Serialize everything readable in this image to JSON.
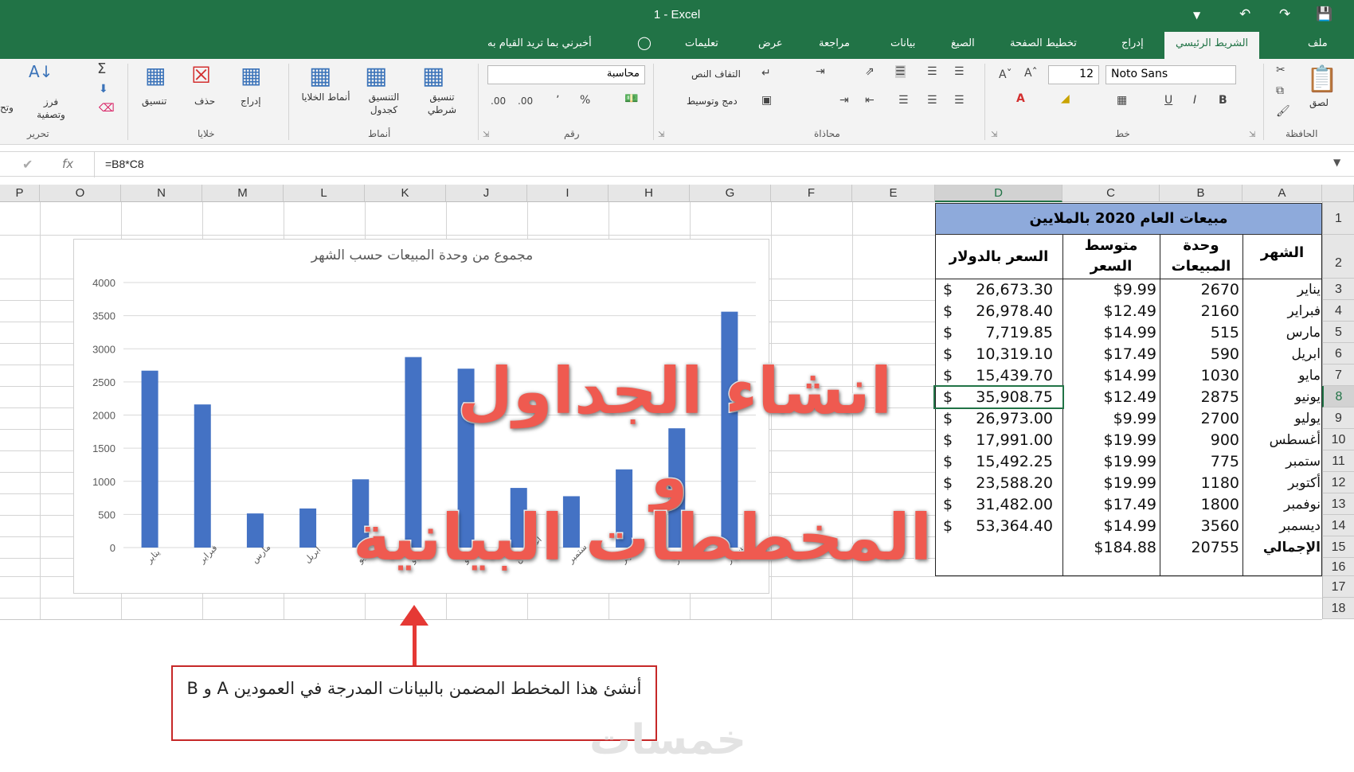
{
  "window": {
    "title": "1  -  Excel"
  },
  "tabs": {
    "file": "ملف",
    "home": "الشريط الرئيسي",
    "insert": "إدراج",
    "page_layout": "تخطيط الصفحة",
    "formulas": "الصيغ",
    "data": "بيانات",
    "review": "مراجعة",
    "view": "عرض",
    "help": "تعليمات",
    "tell_me": "أخبرني بما تريد القيام به"
  },
  "ribbon": {
    "clipboard": {
      "paste": "لصق",
      "group": "الحافظة"
    },
    "font": {
      "name": "Noto Sans",
      "size": "12",
      "bold": "B",
      "italic": "I",
      "underline": "U",
      "group": "خط"
    },
    "alignment": {
      "wrap": "التفاف النص",
      "merge": "دمج وتوسيط",
      "group": "محاذاة"
    },
    "number": {
      "format": "محاسبة",
      "percent": "%",
      "comma": "٬",
      "inc": ".00",
      "dec": ".00",
      "group": "رقم"
    },
    "styles": {
      "conditional": "تنسيق شرطي",
      "as_table": "التنسيق كجدول",
      "cell_styles": "أنماط الخلايا",
      "group": "أنماط"
    },
    "cells": {
      "insert": "إدراج",
      "delete": "حذف",
      "format": "تنسيق",
      "group": "خلايا"
    },
    "editing": {
      "sort": "فرز وتصفية",
      "find": "وتح",
      "group": "تحرير"
    }
  },
  "formula_bar": {
    "fx": "fx",
    "formula": "=B8*C8"
  },
  "columns": [
    "P",
    "O",
    "N",
    "M",
    "L",
    "K",
    "J",
    "I",
    "H",
    "G",
    "F",
    "E",
    "D",
    "C",
    "B",
    "A"
  ],
  "selected_column": "D",
  "rows": [
    "1",
    "2",
    "3",
    "4",
    "5",
    "6",
    "7",
    "8",
    "9",
    "10",
    "11",
    "12",
    "13",
    "14",
    "15",
    "16",
    "17",
    "18"
  ],
  "selected_row": "8",
  "table": {
    "title": "مبيعات العام 2020 بالملايين",
    "headers": {
      "month": "الشهر",
      "units": "وحدة المبيعات",
      "avg_price": "متوسط السعر",
      "price_usd": "السعر بالدولار"
    },
    "currency_symbol": "$",
    "rows": [
      {
        "month": "يناير",
        "units": "2670",
        "avg": "$9.99",
        "total": "26,673.30"
      },
      {
        "month": "فبراير",
        "units": "2160",
        "avg": "$12.49",
        "total": "26,978.40"
      },
      {
        "month": "مارس",
        "units": "515",
        "avg": "$14.99",
        "total": "7,719.85"
      },
      {
        "month": "ابريل",
        "units": "590",
        "avg": "$17.49",
        "total": "10,319.10"
      },
      {
        "month": "مايو",
        "units": "1030",
        "avg": "$14.99",
        "total": "15,439.70"
      },
      {
        "month": "يونيو",
        "units": "2875",
        "avg": "$12.49",
        "total": "35,908.75"
      },
      {
        "month": "يوليو",
        "units": "2700",
        "avg": "$9.99",
        "total": "26,973.00"
      },
      {
        "month": "أغسطس",
        "units": "900",
        "avg": "$19.99",
        "total": "17,991.00"
      },
      {
        "month": "ستمبر",
        "units": "775",
        "avg": "$19.99",
        "total": "15,492.25"
      },
      {
        "month": "أكتوبر",
        "units": "1180",
        "avg": "$19.99",
        "total": "23,588.20"
      },
      {
        "month": "نوفمبر",
        "units": "1800",
        "avg": "$17.49",
        "total": "31,482.00"
      },
      {
        "month": "ديسمبر",
        "units": "3560",
        "avg": "$14.99",
        "total": "53,364.40"
      }
    ],
    "total": {
      "label": "الإجمالي",
      "units": "20755",
      "avg": "$184.88"
    }
  },
  "chart_data": {
    "type": "bar",
    "title": "مجموع من وحدة المبيعات حسب الشهر",
    "categories": [
      "يناير",
      "فبراير",
      "مارس",
      "ابريل",
      "مايو",
      "يونيو",
      "يوليو",
      "أغسطس",
      "ستمبر",
      "أكتوبر",
      "نوفمبر",
      "ديسمبر"
    ],
    "values": [
      2670,
      2160,
      515,
      590,
      1030,
      2875,
      2700,
      900,
      775,
      1180,
      1800,
      3560
    ],
    "ylim": [
      0,
      4000
    ],
    "yticks": [
      "0",
      "500",
      "1000",
      "1500",
      "2000",
      "2500",
      "3000",
      "3500",
      "4000"
    ],
    "bar_color": "#4472c4",
    "grid": true
  },
  "overlay": {
    "line1": "انشاء الجداول",
    "line2": "و",
    "line3": "المخططات البيانية",
    "color": "#ef5a50"
  },
  "callout": {
    "text": "أنشئ هذا المخطط المضمن بالبيانات المدرجة في العمودين A و B"
  },
  "watermark": "خمسات"
}
